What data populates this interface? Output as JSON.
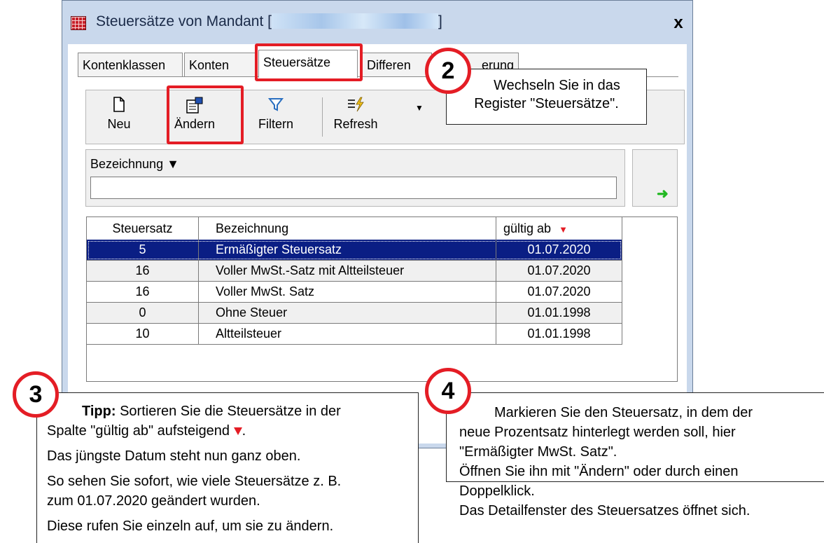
{
  "window": {
    "title_prefix": "Steuersätze von Mandant [",
    "title_suffix": "]",
    "close_label": "x"
  },
  "tabs": [
    "Kontenklassen",
    "Konten",
    "Steuersätze",
    "Differen",
    "erung"
  ],
  "toolbar": {
    "new_label": "Neu",
    "edit_label": "Ändern",
    "filter_label": "Filtern",
    "refresh_label": "Refresh"
  },
  "filter": {
    "label": "Bezeichnung",
    "dropdown_glyph": "▼",
    "value": ""
  },
  "grid": {
    "columns": [
      "Steuersatz",
      "Bezeichnung",
      "gültig ab"
    ],
    "sort_indicator": "▼",
    "rows": [
      {
        "rate": "5",
        "name": "Ermäßigter Steuersatz",
        "valid_from": "01.07.2020"
      },
      {
        "rate": "16",
        "name": "Voller MwSt.-Satz mit Altteilsteuer",
        "valid_from": "01.07.2020"
      },
      {
        "rate": "16",
        "name": "Voller MwSt. Satz",
        "valid_from": "01.07.2020"
      },
      {
        "rate": "0",
        "name": "Ohne Steuer",
        "valid_from": "01.01.1998"
      },
      {
        "rate": "10",
        "name": "Altteilsteuer",
        "valid_from": "01.01.1998"
      }
    ]
  },
  "callouts": {
    "step2": {
      "badge": "2",
      "line1": "Wechseln Sie in das",
      "line2": "Register \"Steuersätze\"."
    },
    "step3": {
      "badge": "3",
      "tip_bold": "Tipp:",
      "tip_rest": " Sortieren Sie die Steuersätze in der",
      "tip_line2": "Spalte \"gültig ab\" aufsteigend",
      "tip_end": ".",
      "p2": "Das jüngste Datum steht nun ganz oben.",
      "p3a": "So sehen Sie sofort, wie viele Steuersätze z. B.",
      "p3b": "zum 01.07.2020 geändert wurden.",
      "p4": "Diese rufen Sie einzeln auf, um sie zu ändern."
    },
    "step4": {
      "badge": "4",
      "l1": "Markieren Sie den Steuersatz, in dem der",
      "l2": "neue Prozentsatz hinterlegt werden soll, hier",
      "l3": "\"Ermäßigter MwSt. Satz\".",
      "l4": "Öffnen Sie ihn mit \"Ändern\" oder durch einen",
      "l5": "Doppelklick.",
      "l6": "Das Detailfenster des Steuersatzes öffnet sich."
    }
  },
  "colors": {
    "highlight": "#e41d25",
    "selection": "#0a1e84",
    "titlebar": "#c9d8ec"
  }
}
